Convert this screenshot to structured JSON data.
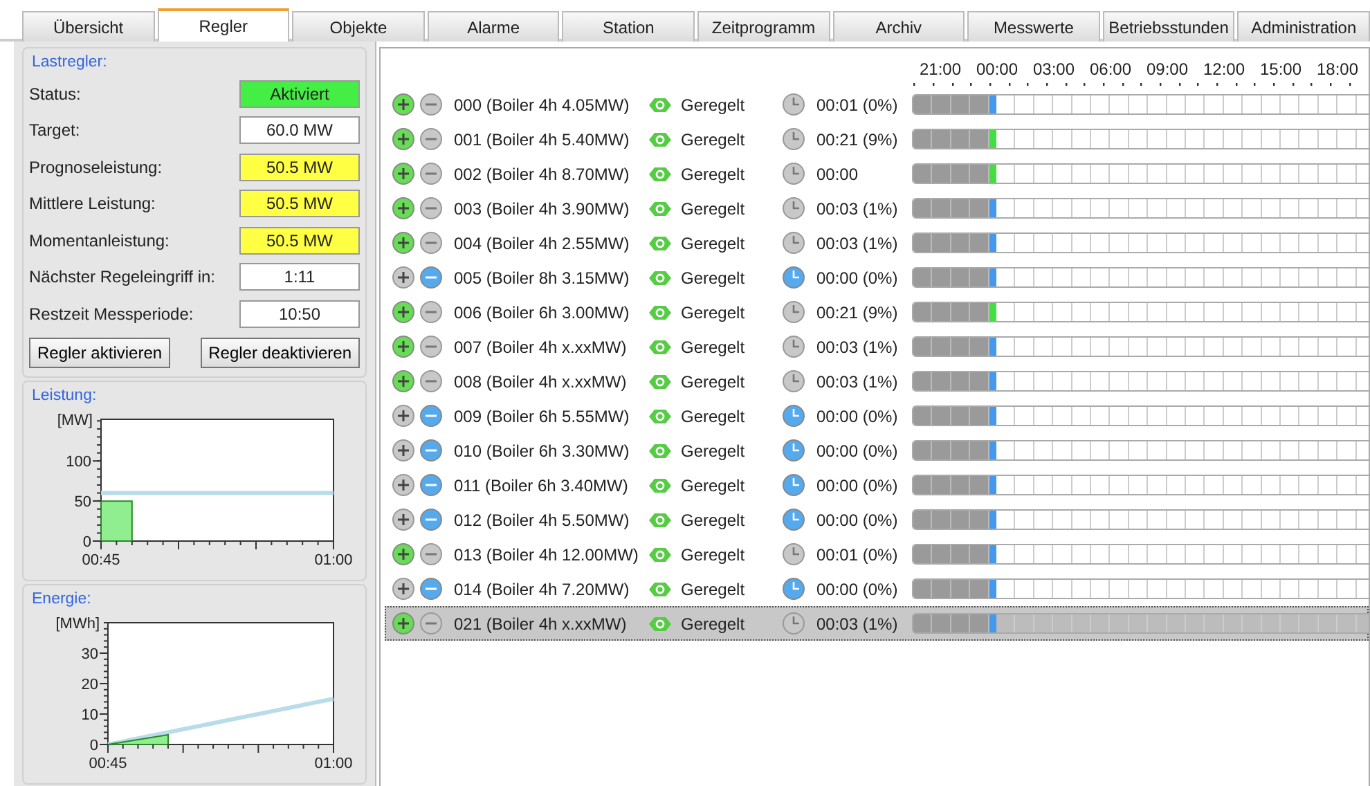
{
  "tabs": [
    {
      "label": "Übersicht",
      "selected": false
    },
    {
      "label": "Regler",
      "selected": true
    },
    {
      "label": "Objekte",
      "selected": false
    },
    {
      "label": "Alarme",
      "selected": false
    },
    {
      "label": "Station",
      "selected": false
    },
    {
      "label": "Zeitprogramm",
      "selected": false
    },
    {
      "label": "Archiv",
      "selected": false
    },
    {
      "label": "Messwerte",
      "selected": false
    },
    {
      "label": "Betriebsstunden",
      "selected": false
    },
    {
      "label": "Administration",
      "selected": false
    }
  ],
  "controller": {
    "title": "Lastregler:",
    "fields": [
      {
        "label": "Status:",
        "value": "Aktiviert",
        "color": "#44ee44"
      },
      {
        "label": "Target:",
        "value": "60.0 MW",
        "color": "#ffffff"
      },
      {
        "label": "Prognoseleistung:",
        "value": "50.5 MW",
        "color": "#ffff44"
      },
      {
        "label": "Mittlere Leistung:",
        "value": "50.5 MW",
        "color": "#ffff44"
      },
      {
        "label": "Momentanleistung:",
        "value": "50.5 MW",
        "color": "#ffff44"
      },
      {
        "label": "Nächster Regeleingriff in:",
        "value": "1:11",
        "color": "#ffffff"
      },
      {
        "label": "Restzeit Messperiode:",
        "value": "10:50",
        "color": "#ffffff"
      }
    ],
    "buttons": [
      "Regler aktivieren",
      "Regler deaktivieren"
    ]
  },
  "power": {
    "title": "Leistung:",
    "chart_data": {
      "type": "area",
      "ylabel": "[MW]",
      "categories": [
        "00:45",
        null,
        null,
        null,
        null,
        null,
        null,
        null,
        null,
        null,
        null,
        null,
        null,
        null,
        null,
        "01:00"
      ],
      "series": [
        {
          "type": "area",
          "color": "#90ee90",
          "values": [
            50,
            50,
            50,
            null,
            null,
            null,
            null,
            null,
            null,
            null,
            null,
            null,
            null,
            null,
            null,
            null
          ]
        },
        {
          "type": "line",
          "color": "#b8dcea",
          "values": [
            60,
            60,
            60,
            60,
            60,
            60,
            60,
            60,
            60,
            60,
            60,
            60,
            60,
            60,
            60,
            60
          ]
        }
      ],
      "ylim": [
        0,
        152
      ],
      "yticks": [
        0,
        50,
        100
      ]
    }
  },
  "energy": {
    "title": "Energie:",
    "chart_data": {
      "type": "area",
      "ylabel": "[MWh]",
      "categories": [
        "00:45",
        null,
        null,
        null,
        null,
        null,
        null,
        null,
        null,
        null,
        null,
        null,
        null,
        null,
        null,
        "01:00"
      ],
      "series": [
        {
          "type": "area",
          "color": "#90ee90",
          "values": [
            0,
            0.8,
            1.6,
            2.4,
            3.2,
            null,
            null,
            null,
            null,
            null,
            null,
            null,
            null,
            null,
            null,
            null
          ]
        },
        {
          "type": "line",
          "color": "#b8dcea",
          "values": [
            0,
            1,
            2,
            3,
            4,
            5,
            6,
            7,
            8,
            9,
            10,
            11,
            12,
            13,
            14,
            15
          ]
        }
      ],
      "ylim": [
        0,
        40
      ],
      "yticks": [
        0,
        10,
        20,
        30
      ]
    }
  },
  "timeline_hours": [
    "21:00",
    "00:00",
    "03:00",
    "06:00",
    "09:00",
    "12:00",
    "15:00",
    "18:00"
  ],
  "objects": [
    {
      "label": "000 (Boiler 4h 4.05MW)",
      "status": "Geregelt",
      "time": "00:01 (0%)",
      "on": true,
      "color": "#4499ee",
      "selected": false
    },
    {
      "label": "001 (Boiler 4h 5.40MW)",
      "status": "Geregelt",
      "time": "00:21 (9%)",
      "on": true,
      "color": "#44dd44",
      "selected": false
    },
    {
      "label": "002 (Boiler 4h 8.70MW)",
      "status": "Geregelt",
      "time": "00:00",
      "on": true,
      "color": "#44dd44",
      "selected": false
    },
    {
      "label": "003 (Boiler 4h 3.90MW)",
      "status": "Geregelt",
      "time": "00:03 (1%)",
      "on": true,
      "color": "#4499ee",
      "selected": false
    },
    {
      "label": "004 (Boiler 4h 2.55MW)",
      "status": "Geregelt",
      "time": "00:03 (1%)",
      "on": true,
      "color": "#4499ee",
      "selected": false
    },
    {
      "label": "005 (Boiler 8h 3.15MW)",
      "status": "Geregelt",
      "time": "00:00 (0%)",
      "on": false,
      "color": "#4499ee",
      "selected": false
    },
    {
      "label": "006 (Boiler 6h 3.00MW)",
      "status": "Geregelt",
      "time": "00:21 (9%)",
      "on": true,
      "color": "#44dd44",
      "selected": false
    },
    {
      "label": "007 (Boiler 4h x.xxMW)",
      "status": "Geregelt",
      "time": "00:03 (1%)",
      "on": true,
      "color": "#4499ee",
      "selected": false
    },
    {
      "label": "008 (Boiler 4h x.xxMW)",
      "status": "Geregelt",
      "time": "00:03 (1%)",
      "on": true,
      "color": "#4499ee",
      "selected": false
    },
    {
      "label": "009 (Boiler 6h 5.55MW)",
      "status": "Geregelt",
      "time": "00:00 (0%)",
      "on": false,
      "color": "#4499ee",
      "selected": false
    },
    {
      "label": "010 (Boiler 6h 3.30MW)",
      "status": "Geregelt",
      "time": "00:00 (0%)",
      "on": false,
      "color": "#4499ee",
      "selected": false
    },
    {
      "label": "011 (Boiler 6h 3.40MW)",
      "status": "Geregelt",
      "time": "00:00 (0%)",
      "on": false,
      "color": "#4499ee",
      "selected": false
    },
    {
      "label": "012 (Boiler 4h 5.50MW)",
      "status": "Geregelt",
      "time": "00:00 (0%)",
      "on": false,
      "color": "#4499ee",
      "selected": false
    },
    {
      "label": "013 (Boiler 4h 12.00MW)",
      "status": "Geregelt",
      "time": "00:01 (0%)",
      "on": true,
      "color": "#4499ee",
      "selected": false
    },
    {
      "label": "014 (Boiler 4h 7.20MW)",
      "status": "Geregelt",
      "time": "00:00 (0%)",
      "on": false,
      "color": "#4499ee",
      "selected": false
    },
    {
      "label": "021 (Boiler 4h x.xxMW)",
      "status": "Geregelt",
      "time": "00:03 (1%)",
      "on": true,
      "color": "#4499ee",
      "selected": true
    }
  ]
}
